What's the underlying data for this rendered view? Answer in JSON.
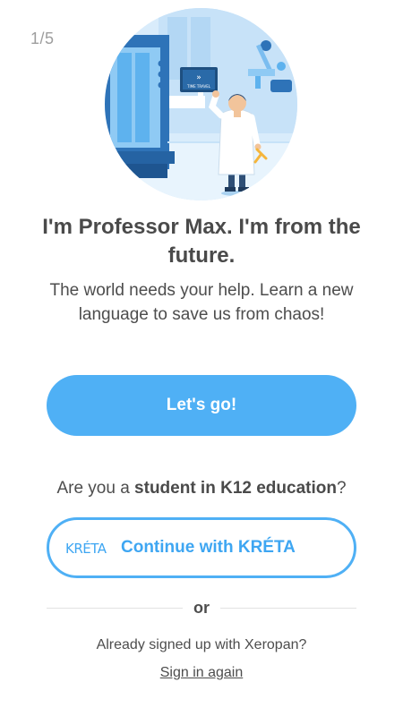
{
  "onboarding": {
    "step_counter": "1/5",
    "illustration": {
      "icon": "professor-max-illustration",
      "screen_text": "TIME TRAVEL"
    },
    "title": "I'm Professor Max. I'm from the future.",
    "subtitle": "The world needs your help. Learn a new language to save us from chaos!",
    "primary_button_label": "Let's go!"
  },
  "k12": {
    "question_prefix": "Are you a ",
    "question_bold": "student in K12 education",
    "question_suffix": "?",
    "kreta_logo_text": "KRÉTA",
    "kreta_button_label": "Continue with KRÉTA"
  },
  "divider_text": "or",
  "signin": {
    "already_text": "Already signed up with Xeropan?",
    "link_label": "Sign in again"
  },
  "colors": {
    "accent": "#4fb0f5",
    "text": "#4a4a4a",
    "muted": "#9e9e9e"
  }
}
